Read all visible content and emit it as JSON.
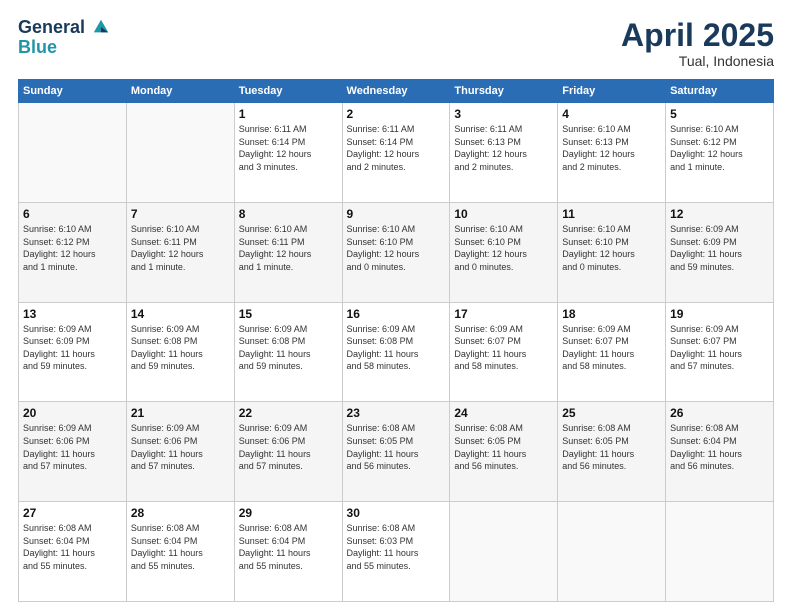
{
  "header": {
    "logo_line1": "General",
    "logo_line2": "Blue",
    "month_year": "April 2025",
    "location": "Tual, Indonesia"
  },
  "weekdays": [
    "Sunday",
    "Monday",
    "Tuesday",
    "Wednesday",
    "Thursday",
    "Friday",
    "Saturday"
  ],
  "weeks": [
    [
      {
        "day": "",
        "info": ""
      },
      {
        "day": "",
        "info": ""
      },
      {
        "day": "1",
        "info": "Sunrise: 6:11 AM\nSunset: 6:14 PM\nDaylight: 12 hours\nand 3 minutes."
      },
      {
        "day": "2",
        "info": "Sunrise: 6:11 AM\nSunset: 6:14 PM\nDaylight: 12 hours\nand 2 minutes."
      },
      {
        "day": "3",
        "info": "Sunrise: 6:11 AM\nSunset: 6:13 PM\nDaylight: 12 hours\nand 2 minutes."
      },
      {
        "day": "4",
        "info": "Sunrise: 6:10 AM\nSunset: 6:13 PM\nDaylight: 12 hours\nand 2 minutes."
      },
      {
        "day": "5",
        "info": "Sunrise: 6:10 AM\nSunset: 6:12 PM\nDaylight: 12 hours\nand 1 minute."
      }
    ],
    [
      {
        "day": "6",
        "info": "Sunrise: 6:10 AM\nSunset: 6:12 PM\nDaylight: 12 hours\nand 1 minute."
      },
      {
        "day": "7",
        "info": "Sunrise: 6:10 AM\nSunset: 6:11 PM\nDaylight: 12 hours\nand 1 minute."
      },
      {
        "day": "8",
        "info": "Sunrise: 6:10 AM\nSunset: 6:11 PM\nDaylight: 12 hours\nand 1 minute."
      },
      {
        "day": "9",
        "info": "Sunrise: 6:10 AM\nSunset: 6:10 PM\nDaylight: 12 hours\nand 0 minutes."
      },
      {
        "day": "10",
        "info": "Sunrise: 6:10 AM\nSunset: 6:10 PM\nDaylight: 12 hours\nand 0 minutes."
      },
      {
        "day": "11",
        "info": "Sunrise: 6:10 AM\nSunset: 6:10 PM\nDaylight: 12 hours\nand 0 minutes."
      },
      {
        "day": "12",
        "info": "Sunrise: 6:09 AM\nSunset: 6:09 PM\nDaylight: 11 hours\nand 59 minutes."
      }
    ],
    [
      {
        "day": "13",
        "info": "Sunrise: 6:09 AM\nSunset: 6:09 PM\nDaylight: 11 hours\nand 59 minutes."
      },
      {
        "day": "14",
        "info": "Sunrise: 6:09 AM\nSunset: 6:08 PM\nDaylight: 11 hours\nand 59 minutes."
      },
      {
        "day": "15",
        "info": "Sunrise: 6:09 AM\nSunset: 6:08 PM\nDaylight: 11 hours\nand 59 minutes."
      },
      {
        "day": "16",
        "info": "Sunrise: 6:09 AM\nSunset: 6:08 PM\nDaylight: 11 hours\nand 58 minutes."
      },
      {
        "day": "17",
        "info": "Sunrise: 6:09 AM\nSunset: 6:07 PM\nDaylight: 11 hours\nand 58 minutes."
      },
      {
        "day": "18",
        "info": "Sunrise: 6:09 AM\nSunset: 6:07 PM\nDaylight: 11 hours\nand 58 minutes."
      },
      {
        "day": "19",
        "info": "Sunrise: 6:09 AM\nSunset: 6:07 PM\nDaylight: 11 hours\nand 57 minutes."
      }
    ],
    [
      {
        "day": "20",
        "info": "Sunrise: 6:09 AM\nSunset: 6:06 PM\nDaylight: 11 hours\nand 57 minutes."
      },
      {
        "day": "21",
        "info": "Sunrise: 6:09 AM\nSunset: 6:06 PM\nDaylight: 11 hours\nand 57 minutes."
      },
      {
        "day": "22",
        "info": "Sunrise: 6:09 AM\nSunset: 6:06 PM\nDaylight: 11 hours\nand 57 minutes."
      },
      {
        "day": "23",
        "info": "Sunrise: 6:08 AM\nSunset: 6:05 PM\nDaylight: 11 hours\nand 56 minutes."
      },
      {
        "day": "24",
        "info": "Sunrise: 6:08 AM\nSunset: 6:05 PM\nDaylight: 11 hours\nand 56 minutes."
      },
      {
        "day": "25",
        "info": "Sunrise: 6:08 AM\nSunset: 6:05 PM\nDaylight: 11 hours\nand 56 minutes."
      },
      {
        "day": "26",
        "info": "Sunrise: 6:08 AM\nSunset: 6:04 PM\nDaylight: 11 hours\nand 56 minutes."
      }
    ],
    [
      {
        "day": "27",
        "info": "Sunrise: 6:08 AM\nSunset: 6:04 PM\nDaylight: 11 hours\nand 55 minutes."
      },
      {
        "day": "28",
        "info": "Sunrise: 6:08 AM\nSunset: 6:04 PM\nDaylight: 11 hours\nand 55 minutes."
      },
      {
        "day": "29",
        "info": "Sunrise: 6:08 AM\nSunset: 6:04 PM\nDaylight: 11 hours\nand 55 minutes."
      },
      {
        "day": "30",
        "info": "Sunrise: 6:08 AM\nSunset: 6:03 PM\nDaylight: 11 hours\nand 55 minutes."
      },
      {
        "day": "",
        "info": ""
      },
      {
        "day": "",
        "info": ""
      },
      {
        "day": "",
        "info": ""
      }
    ]
  ]
}
